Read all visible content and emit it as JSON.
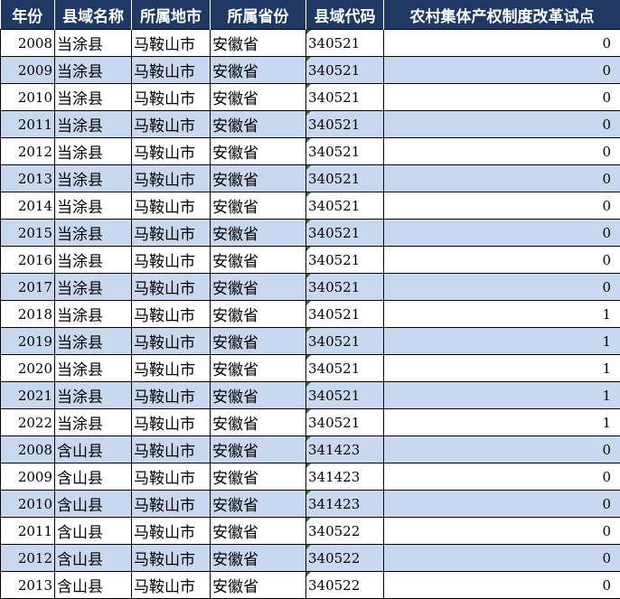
{
  "headers": [
    "年份",
    "县域名称",
    "所属地市",
    "所属省份",
    "县域代码",
    "农村集体产权制度改革试点"
  ],
  "colors": {
    "header_bg": "#1f3864",
    "alt_row_bg": "#c9d8ee",
    "text_indicator": "#1f7a3a"
  },
  "rows": [
    {
      "year": "2008",
      "county": "当涂县",
      "city": "马鞍山市",
      "province": "安徽省",
      "code": "340521",
      "value": "0"
    },
    {
      "year": "2009",
      "county": "当涂县",
      "city": "马鞍山市",
      "province": "安徽省",
      "code": "340521",
      "value": "0"
    },
    {
      "year": "2010",
      "county": "当涂县",
      "city": "马鞍山市",
      "province": "安徽省",
      "code": "340521",
      "value": "0"
    },
    {
      "year": "2011",
      "county": "当涂县",
      "city": "马鞍山市",
      "province": "安徽省",
      "code": "340521",
      "value": "0"
    },
    {
      "year": "2012",
      "county": "当涂县",
      "city": "马鞍山市",
      "province": "安徽省",
      "code": "340521",
      "value": "0"
    },
    {
      "year": "2013",
      "county": "当涂县",
      "city": "马鞍山市",
      "province": "安徽省",
      "code": "340521",
      "value": "0"
    },
    {
      "year": "2014",
      "county": "当涂县",
      "city": "马鞍山市",
      "province": "安徽省",
      "code": "340521",
      "value": "0"
    },
    {
      "year": "2015",
      "county": "当涂县",
      "city": "马鞍山市",
      "province": "安徽省",
      "code": "340521",
      "value": "0"
    },
    {
      "year": "2016",
      "county": "当涂县",
      "city": "马鞍山市",
      "province": "安徽省",
      "code": "340521",
      "value": "0"
    },
    {
      "year": "2017",
      "county": "当涂县",
      "city": "马鞍山市",
      "province": "安徽省",
      "code": "340521",
      "value": "0"
    },
    {
      "year": "2018",
      "county": "当涂县",
      "city": "马鞍山市",
      "province": "安徽省",
      "code": "340521",
      "value": "1"
    },
    {
      "year": "2019",
      "county": "当涂县",
      "city": "马鞍山市",
      "province": "安徽省",
      "code": "340521",
      "value": "1"
    },
    {
      "year": "2020",
      "county": "当涂县",
      "city": "马鞍山市",
      "province": "安徽省",
      "code": "340521",
      "value": "1"
    },
    {
      "year": "2021",
      "county": "当涂县",
      "city": "马鞍山市",
      "province": "安徽省",
      "code": "340521",
      "value": "1"
    },
    {
      "year": "2022",
      "county": "当涂县",
      "city": "马鞍山市",
      "province": "安徽省",
      "code": "340521",
      "value": "1"
    },
    {
      "year": "2008",
      "county": "含山县",
      "city": "马鞍山市",
      "province": "安徽省",
      "code": "341423",
      "value": "0"
    },
    {
      "year": "2009",
      "county": "含山县",
      "city": "马鞍山市",
      "province": "安徽省",
      "code": "341423",
      "value": "0"
    },
    {
      "year": "2010",
      "county": "含山县",
      "city": "马鞍山市",
      "province": "安徽省",
      "code": "341423",
      "value": "0"
    },
    {
      "year": "2011",
      "county": "含山县",
      "city": "马鞍山市",
      "province": "安徽省",
      "code": "340522",
      "value": "0"
    },
    {
      "year": "2012",
      "county": "含山县",
      "city": "马鞍山市",
      "province": "安徽省",
      "code": "340522",
      "value": "0"
    },
    {
      "year": "2013",
      "county": "含山县",
      "city": "马鞍山市",
      "province": "安徽省",
      "code": "340522",
      "value": "0"
    }
  ]
}
